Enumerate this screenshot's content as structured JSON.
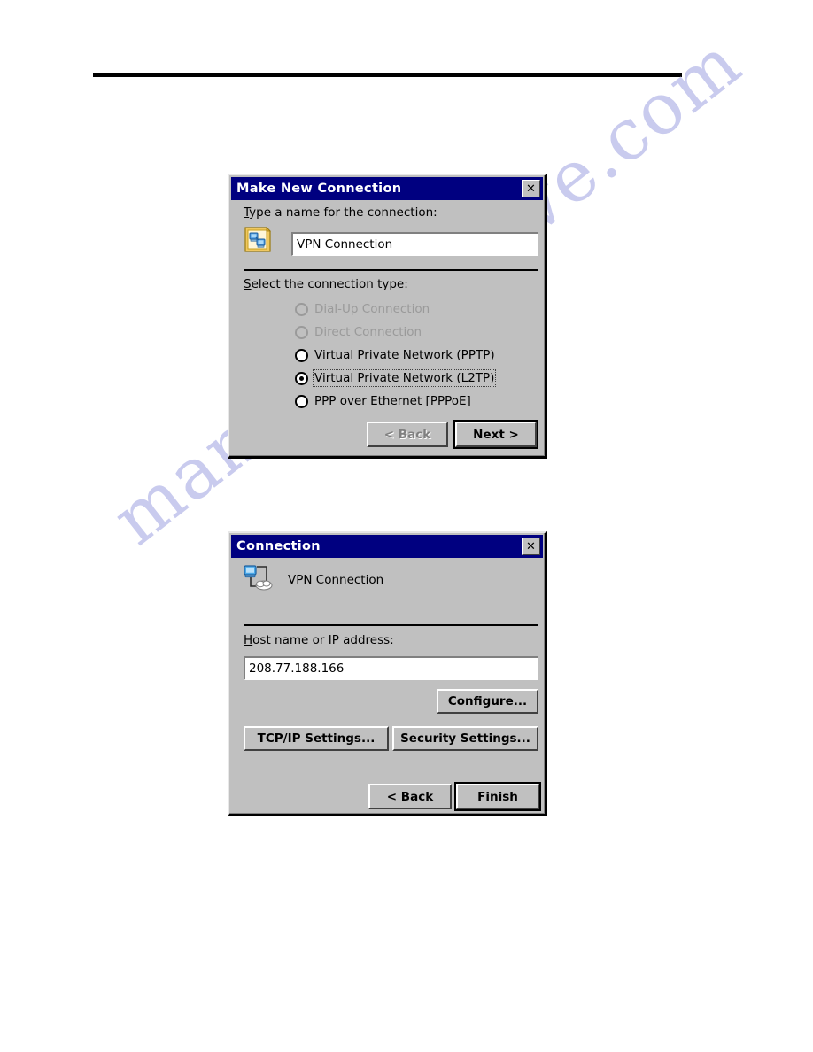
{
  "page": {
    "watermark": "manualsarchive.com"
  },
  "dialog_make_new": {
    "title": "Make New Connection",
    "close_label": "✕",
    "icon": "network-folder-icon",
    "name_prompt": "Type a name for the connection:",
    "name_prompt_mnemonic": "T",
    "name_value": "VPN Connection",
    "type_prompt": "Select the connection type:",
    "type_prompt_mnemonic": "S",
    "options": [
      {
        "label": "Dial-Up Connection",
        "mnemonic": "D",
        "selected": false,
        "disabled": true
      },
      {
        "label": "Direct Connection",
        "mnemonic": "i",
        "selected": false,
        "disabled": true
      },
      {
        "label": "Virtual Private Network (PPTP)",
        "mnemonic": "V",
        "selected": false,
        "disabled": false
      },
      {
        "label": "Virtual Private Network (L2TP)",
        "mnemonic": "Vi",
        "selected": true,
        "disabled": false
      },
      {
        "label": "PPP over Ethernet [PPPoE]",
        "mnemonic": "P",
        "selected": false,
        "disabled": false
      }
    ],
    "back_label": "< Back",
    "back_disabled": true,
    "next_label": "Next >",
    "next_default": true
  },
  "dialog_connection": {
    "title": "Connection",
    "close_label": "✕",
    "icon": "vpn-connection-icon",
    "connection_name": "VPN Connection",
    "host_prompt": "Host name or IP address:",
    "host_prompt_mnemonic": "H",
    "host_value": "208.77.188.166",
    "configure_label": "Configure...",
    "tcpip_label": "TCP/IP Settings...",
    "security_label": "Security Settings...",
    "back_label": "< Back",
    "finish_label": "Finish",
    "finish_default": true
  },
  "colors": {
    "titlebar": "#000080",
    "dialog_face": "#c0c0c0",
    "watermark": "#c9cbee",
    "disabled_text": "#9a9a9a"
  }
}
